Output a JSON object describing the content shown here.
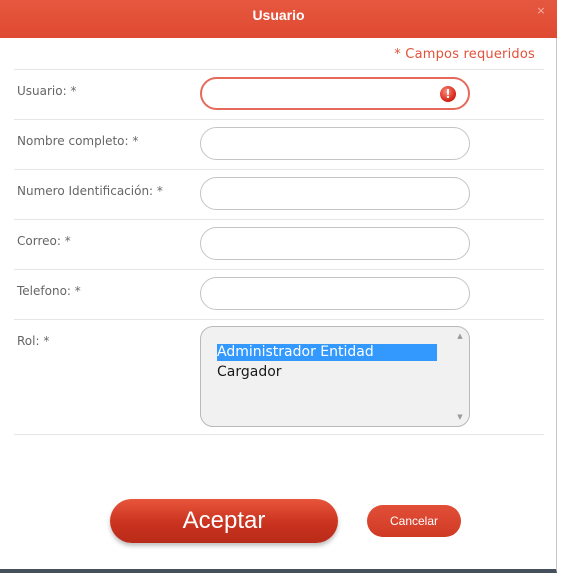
{
  "dialog": {
    "title": "Usuario",
    "close_icon": "close-icon",
    "close_glyph": "×",
    "required_note": "* Campos requeridos"
  },
  "form": {
    "usuario": {
      "label": "Usuario: *",
      "value": "",
      "error_glyph": "!"
    },
    "nombre": {
      "label": "Nombre completo: *",
      "value": ""
    },
    "identificacion": {
      "label": "Numero Identificación: *",
      "value": ""
    },
    "correo": {
      "label": "Correo: *",
      "value": ""
    },
    "telefono": {
      "label": "Telefono: *",
      "value": ""
    },
    "rol": {
      "label": "Rol: *",
      "options": [
        "Administrador Entidad",
        "Cargador"
      ],
      "selected": "Administrador Entidad",
      "scroll_up_glyph": "▲",
      "scroll_down_glyph": "▼"
    }
  },
  "buttons": {
    "accept": "Aceptar",
    "cancel": "Cancelar"
  },
  "colors": {
    "header": "#de4a31",
    "accent": "#e2513a",
    "selected": "#3399ff",
    "error": "#e66a5b"
  }
}
